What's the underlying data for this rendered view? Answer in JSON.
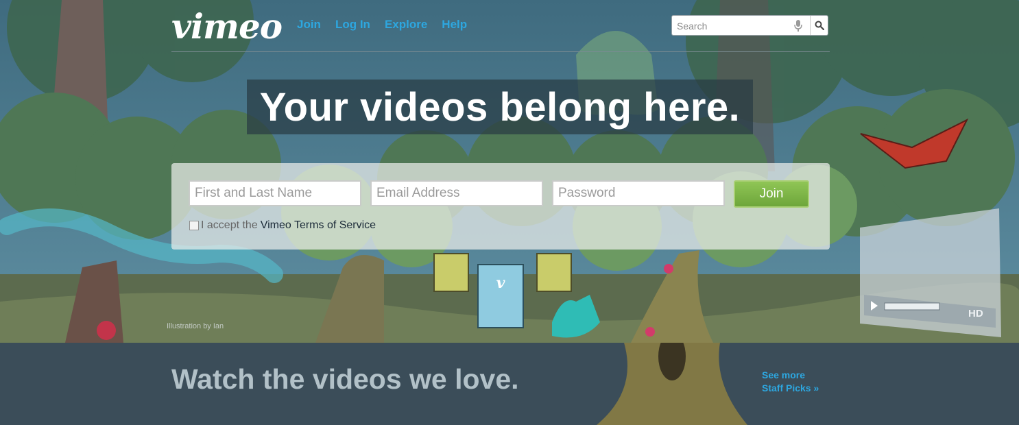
{
  "header": {
    "logo_text": "vimeo",
    "nav": [
      {
        "label": "Join"
      },
      {
        "label": "Log In"
      },
      {
        "label": "Explore"
      },
      {
        "label": "Help"
      }
    ],
    "search": {
      "placeholder": "Search",
      "value": ""
    }
  },
  "hero": {
    "headline": "Your videos belong here.",
    "credit": "Illustration by Ian"
  },
  "signup": {
    "name_placeholder": "First and Last Name",
    "email_placeholder": "Email Address",
    "password_placeholder": "Password",
    "join_label": "Join",
    "terms_prefix": "I accept the",
    "terms_link": "Vimeo Terms of Service",
    "terms_checked": false
  },
  "staff_picks": {
    "title": "Watch the videos we love.",
    "see_more_line1": "See more",
    "see_more_line2": "Staff Picks »"
  },
  "player_badge": "HD",
  "colors": {
    "link_blue": "#2da7e0",
    "join_green": "#7cb648",
    "band_bg": "#3b4d59",
    "headline_bg": "#283c44"
  },
  "icons": [
    "microphone-icon",
    "search-icon",
    "play-icon",
    "checkbox-icon"
  ]
}
